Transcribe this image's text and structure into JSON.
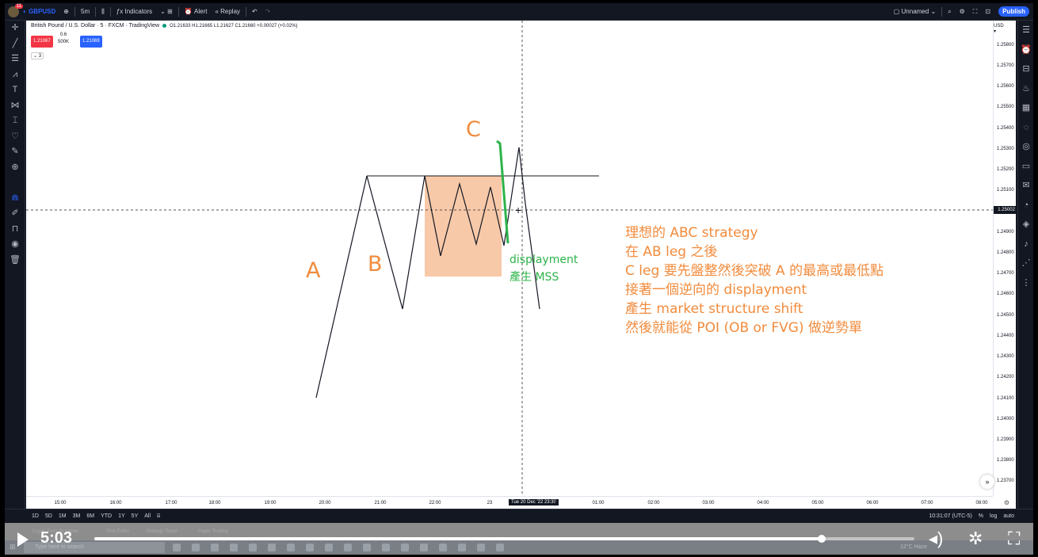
{
  "topbar": {
    "avatar_badge": "11",
    "symbol": "GBPUSD",
    "interval": "5m",
    "indicators": "Indicators",
    "alert": "Alert",
    "replay": "Replay",
    "layout_name": "Unnamed",
    "publish": "Publish"
  },
  "legend": {
    "title": "British Pound / U.S. Dollar · 5 · FXCM · TradingView",
    "ohlc": "O1.21633  H1.21665  L1.21627  C1.21660  +0.00027 (+0.02%)",
    "sell_price": "1.21067",
    "buy_price": "1.21069",
    "spread": "0.6",
    "volume": "500K",
    "collapse": "⌄ 3"
  },
  "price_scale": {
    "currency": "USD ▾",
    "ticks": [
      "1.25800",
      "1.25700",
      "1.25600",
      "1.25500",
      "1.25400",
      "1.25300",
      "1.25200",
      "1.25100",
      "1.24900",
      "1.24800",
      "1.24700",
      "1.24600",
      "1.24500",
      "1.24400",
      "1.24300",
      "1.24200",
      "1.24100",
      "1.24000",
      "1.23900",
      "1.23800",
      "1.23700"
    ],
    "current": "1.25002"
  },
  "time_scale": {
    "ticks": [
      "15:00",
      "16:00",
      "17:00",
      "18:00",
      "19:00",
      "20:00",
      "21:00",
      "22:00",
      "23",
      "01:00",
      "02:00",
      "03:00",
      "04:00",
      "05:00",
      "06:00",
      "07:00",
      "08:00"
    ],
    "cursor_time": "Tue 20 Dec '22   23:30",
    "cursor_tail": "1"
  },
  "annotations": {
    "label_a": "A",
    "label_b": "B",
    "label_c": "C",
    "displacement_1": "displayment",
    "displacement_2": "產生 MSS",
    "note_lines": [
      "理想的 ABC strategy",
      "在 AB leg 之後",
      "C leg 要先盤整然後突破 A 的最高或最低點",
      "接著一個逆向的 displayment",
      "產生 market structure shift",
      "然後就能從 POI (OB or FVG) 做逆勢單"
    ]
  },
  "bottombar": {
    "ranges": [
      "1D",
      "5D",
      "1M",
      "3M",
      "6M",
      "YTD",
      "1Y",
      "5Y",
      "All"
    ],
    "clock": "10:31:07 (UTC-5)",
    "percent": "%",
    "log": "log",
    "auto": "auto"
  },
  "panel_tabs": [
    "Crypto Pairs Screener",
    "Pine Editor",
    "Strategy Tester",
    "Paper Trading"
  ],
  "taskbar": {
    "search_placeholder": "Type here to search",
    "weather": "12°C Haze"
  },
  "player": {
    "time": "5:03",
    "progress": 0.887
  },
  "colors": {
    "orange": "#f28b3c",
    "green": "#2db34a",
    "box": "#f7bf99"
  }
}
